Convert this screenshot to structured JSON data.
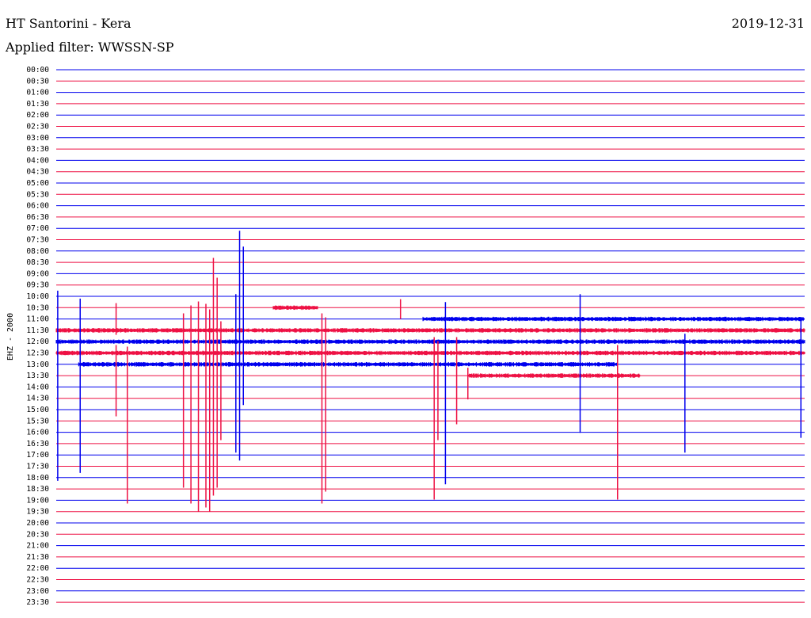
{
  "header": {
    "title": "HT Santorini - Kera",
    "filter_text": "Applied filter: WWSSN-SP",
    "date": "2019-12-31"
  },
  "colors": {
    "blue_trace": "#0000ee",
    "red_trace": "#ee1144"
  },
  "chart_data": {
    "type": "line",
    "ylabel": "EHZ - 2000",
    "row_labels": [
      "00:00",
      "00:30",
      "01:00",
      "01:30",
      "02:00",
      "02:30",
      "03:00",
      "03:30",
      "04:00",
      "04:30",
      "05:00",
      "05:30",
      "06:00",
      "06:30",
      "07:00",
      "07:30",
      "08:00",
      "08:30",
      "09:00",
      "09:30",
      "10:00",
      "10:30",
      "11:00",
      "11:30",
      "12:00",
      "12:30",
      "13:00",
      "13:30",
      "14:00",
      "14:30",
      "15:00",
      "15:30",
      "16:00",
      "16:30",
      "17:00",
      "17:30",
      "18:00",
      "18:30",
      "19:00",
      "19:30",
      "20:00",
      "20:30",
      "21:00",
      "21:30",
      "22:00",
      "22:30",
      "23:00",
      "23:30"
    ],
    "row_colors": [
      "blue",
      "red"
    ],
    "x_range_fraction": [
      0,
      1
    ],
    "row_segments": {
      "21": [
        [
          0.29,
          0.35
        ]
      ],
      "22": [
        [
          0.49,
          1.0
        ]
      ],
      "23": [
        [
          0.0,
          1.0
        ]
      ],
      "24": [
        [
          0.0,
          1.0
        ]
      ],
      "25": [
        [
          0.0,
          1.0
        ]
      ],
      "26": [
        [
          0.03,
          0.75
        ]
      ],
      "27": [
        [
          0.55,
          0.78
        ]
      ]
    },
    "bursts": [
      {
        "row": 23,
        "x": 0.002,
        "up": 50,
        "down": 190,
        "color": "blue"
      },
      {
        "row": 23,
        "x": 0.032,
        "up": 40,
        "down": 180,
        "color": "blue"
      },
      {
        "row": 22,
        "x": 0.08,
        "up": 20,
        "down": 20,
        "color": "red"
      },
      {
        "row": 25,
        "x": 0.08,
        "up": 10,
        "down": 80,
        "color": "red"
      },
      {
        "row": 25,
        "x": 0.095,
        "up": 8,
        "down": 190,
        "color": "red"
      },
      {
        "row": 25,
        "x": 0.17,
        "up": 50,
        "down": 170,
        "color": "red"
      },
      {
        "row": 25,
        "x": 0.18,
        "up": 60,
        "down": 190,
        "color": "red"
      },
      {
        "row": 25,
        "x": 0.19,
        "up": 65,
        "down": 200,
        "color": "red"
      },
      {
        "row": 25,
        "x": 0.2,
        "up": 62,
        "down": 195,
        "color": "red"
      },
      {
        "row": 25,
        "x": 0.205,
        "up": 55,
        "down": 200,
        "color": "red"
      },
      {
        "row": 25,
        "x": 0.21,
        "up": 120,
        "down": 180,
        "color": "red"
      },
      {
        "row": 25,
        "x": 0.215,
        "up": 95,
        "down": 170,
        "color": "red"
      },
      {
        "row": 25,
        "x": 0.22,
        "up": 40,
        "down": 110,
        "color": "red"
      },
      {
        "row": 24,
        "x": 0.24,
        "up": 60,
        "down": 140,
        "color": "blue"
      },
      {
        "row": 24,
        "x": 0.245,
        "up": 140,
        "down": 150,
        "color": "blue"
      },
      {
        "row": 24,
        "x": 0.25,
        "up": 120,
        "down": 80,
        "color": "blue"
      },
      {
        "row": 25,
        "x": 0.355,
        "up": 50,
        "down": 190,
        "color": "red"
      },
      {
        "row": 25,
        "x": 0.36,
        "up": 45,
        "down": 175,
        "color": "red"
      },
      {
        "row": 22,
        "x": 0.46,
        "up": 25,
        "down": 0,
        "color": "red"
      },
      {
        "row": 25,
        "x": 0.505,
        "up": 20,
        "down": 185,
        "color": "red"
      },
      {
        "row": 25,
        "x": 0.51,
        "up": 15,
        "down": 110,
        "color": "red"
      },
      {
        "row": 24,
        "x": 0.52,
        "up": 50,
        "down": 180,
        "color": "blue"
      },
      {
        "row": 25,
        "x": 0.535,
        "up": 20,
        "down": 90,
        "color": "red"
      },
      {
        "row": 27,
        "x": 0.55,
        "up": 10,
        "down": 30,
        "color": "red"
      },
      {
        "row": 24,
        "x": 0.7,
        "up": 60,
        "down": 115,
        "color": "blue"
      },
      {
        "row": 25,
        "x": 0.75,
        "up": 10,
        "down": 185,
        "color": "red"
      },
      {
        "row": 24,
        "x": 0.84,
        "up": 10,
        "down": 140,
        "color": "blue"
      },
      {
        "row": 22,
        "x": 0.995,
        "up": 0,
        "down": 150,
        "color": "blue"
      }
    ]
  }
}
